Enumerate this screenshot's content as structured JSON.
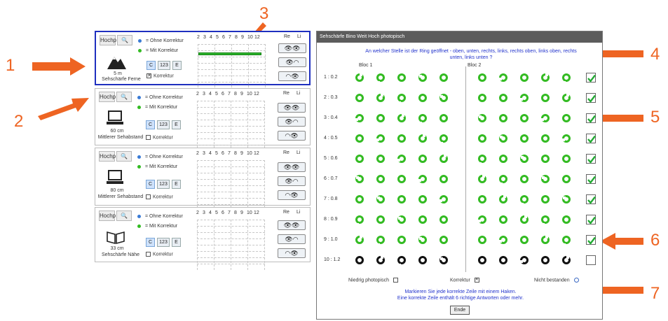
{
  "callouts": [
    "1",
    "2",
    "3",
    "4",
    "5",
    "6",
    "7"
  ],
  "panels": [
    {
      "hochp": "Hochp",
      "zoom": "🔍",
      "dist": "5 m",
      "desc": "Sehschärfe Ferne",
      "korrektur": "Korrektur",
      "korr_checked": "✕"
    },
    {
      "hochp": "Hochp",
      "zoom": "🔍",
      "dist": "60 cm",
      "desc": "Mittlerer Sehabstand",
      "korrektur": "Korrektur",
      "korr_checked": ""
    },
    {
      "hochp": "Hochp",
      "zoom": "🔍",
      "dist": "80 cm",
      "desc": "Mittlerer Sehabstand",
      "korrektur": "Korrektur",
      "korr_checked": ""
    },
    {
      "hochp": "Hochp",
      "zoom": "🔍",
      "dist": "33 cm",
      "desc": "Sehschärfe Nähe",
      "korrektur": "Korrektur",
      "korr_checked": ""
    }
  ],
  "legend": {
    "ohne": "= Ohne Korrektur",
    "mit": "= Mit Korrektur"
  },
  "buttons": {
    "c": "C",
    "num": "123",
    "e": "E"
  },
  "scale": [
    "2",
    "3",
    "4",
    "5",
    "6",
    "7",
    "8",
    "9",
    "10",
    "12"
  ],
  "eye_header": {
    "re": "Re",
    "li": "Li"
  },
  "dialog": {
    "title": "Sehschärfe Bino Weit Hoch photopisch",
    "question": "An welcher Stelle ist der Ring geöffnet - oben, unten, rechts, links, rechts oben, links oben, rechts unten, links unten ?",
    "bloc1": "Bloc 1",
    "bloc2": "Bloc 2",
    "rows": [
      "1 : 0.2",
      "2 : 0.3",
      "3 : 0.4",
      "4 : 0.5",
      "5 : 0.6",
      "6 : 0.7",
      "7 : 0.8",
      "8 : 0.9",
      "9 : 1.0",
      "10 : 1.2"
    ],
    "checked": [
      true,
      true,
      true,
      true,
      true,
      true,
      true,
      true,
      true,
      false
    ],
    "niedrig": "Niedrig photopisch",
    "korrektur": "Korrektur",
    "korr_mark": "✕",
    "nicht": "Nicht bestanden",
    "instr1": "Markieren Sie jede korrekte Zeile mit einem Haken.",
    "instr2": "Eine korrekte Zeile enthält 6 richtige Antworten oder mehr.",
    "ende": "Ende"
  },
  "colors": {
    "accent": "#ee6422",
    "green": "#33bb22",
    "blue": "#1e2fbf"
  }
}
